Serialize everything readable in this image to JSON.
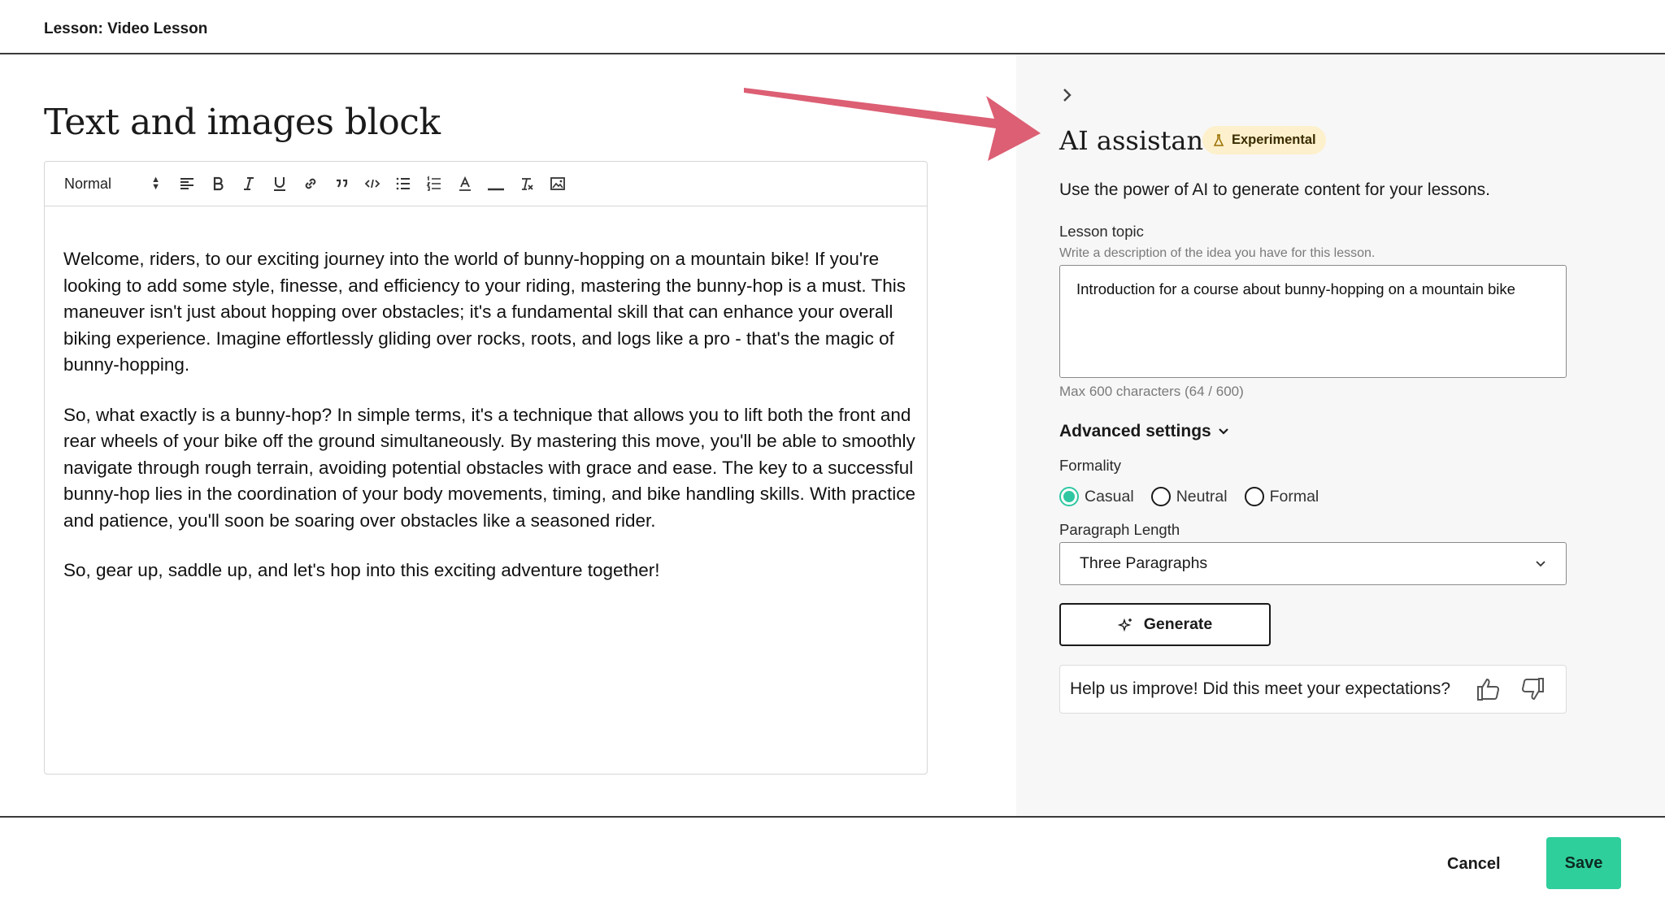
{
  "header": {
    "title": "Lesson: Video Lesson"
  },
  "editor": {
    "block_title": "Text and images block",
    "toolbar": {
      "style_select": "Normal"
    },
    "paragraphs": [
      "Welcome, riders, to our exciting journey into the world of bunny-hopping on a mountain bike! If you're looking to add some style, finesse, and efficiency to your riding, mastering the bunny-hop is a must. This maneuver isn't just about hopping over obstacles; it's a fundamental skill that can enhance your overall biking experience. Imagine effortlessly gliding over rocks, roots, and logs like a pro - that's the magic of bunny-hopping.",
      "So, what exactly is a bunny-hop? In simple terms, it's a technique that allows you to lift both the front and rear wheels of your bike off the ground simultaneously. By mastering this move, you'll be able to smoothly navigate through rough terrain, avoiding potential obstacles with grace and ease. The key to a successful bunny-hop lies in the coordination of your body movements, timing, and bike handling skills. With practice and patience, you'll soon be soaring over obstacles like a seasoned rider.",
      "So, gear up, saddle up, and let's hop into this exciting adventure together!"
    ]
  },
  "ai_panel": {
    "title": "AI assistant",
    "badge": "Experimental",
    "description": "Use the power of AI to generate content for your lessons.",
    "topic": {
      "label": "Lesson topic",
      "hint": "Write a description of the idea you have for this lesson.",
      "value": "Introduction for a course about bunny-hopping on a mountain bike",
      "counter": "Max 600 characters (64 / 600)"
    },
    "advanced_label": "Advanced settings",
    "formality": {
      "label": "Formality",
      "options": [
        "Casual",
        "Neutral",
        "Formal"
      ],
      "selected": "Casual"
    },
    "paragraph_length": {
      "label": "Paragraph Length",
      "value": "Three Paragraphs"
    },
    "generate_label": "Generate",
    "feedback_text": "Help us improve! Did this meet your expectations?"
  },
  "footer": {
    "cancel_label": "Cancel",
    "save_label": "Save"
  },
  "colors": {
    "accent": "#2fcf9c",
    "radio_selected": "#2ec7a2",
    "badge_bg": "#fdf0cc",
    "arrow": "#dc5f74"
  }
}
